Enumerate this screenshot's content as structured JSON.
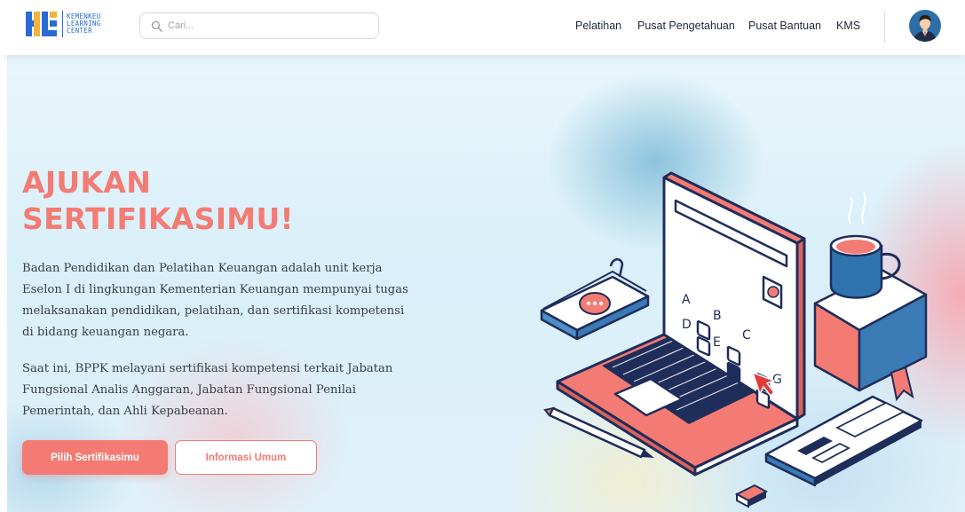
{
  "header": {
    "logo": {
      "text_lines": [
        "KEMENKEU",
        "LEARNING",
        "CENTER"
      ],
      "icon": "klc-logo-icon"
    },
    "search": {
      "placeholder": "Cari...",
      "value": "",
      "icon": "search-icon"
    },
    "nav": {
      "items": [
        {
          "label": "Pelatihan"
        },
        {
          "label": "Pusat Pengetahuan"
        },
        {
          "label": "Pusat Bantuan"
        },
        {
          "label": "KMS"
        }
      ]
    },
    "avatar_icon": "user-avatar-icon"
  },
  "hero": {
    "title_line1": "AJUKAN",
    "title_line2": "SERTIFIKASIMU!",
    "paragraph1": "Badan Pendidikan dan Pelatihan Keuangan adalah unit kerja Eselon I di lingkungan Kementerian Keuangan mempunyai tugas melaksanakan pendidikan, pelatihan, dan sertifikasi kompetensi di bidang keuangan negara.",
    "paragraph2": "Saat ini, BPPK melayani sertifikasi kompetensi terkait Jabatan Fungsional Analis Anggaran, Jabatan Fungsional Penilai Pemerintah, dan Ahli Kepabeanan.",
    "primary_button": "Pilih Sertifikasimu",
    "secondary_button": "Informasi Umum",
    "illustration": {
      "icon": "laptop-quiz-illustration",
      "answer_letters": [
        "A",
        "B",
        "C",
        "D",
        "E",
        "G"
      ]
    }
  },
  "colors": {
    "accent": "#f47b73",
    "brand_blue": "#2a6bd3",
    "navy": "#1f2d5a",
    "text": "#3a3f47"
  }
}
